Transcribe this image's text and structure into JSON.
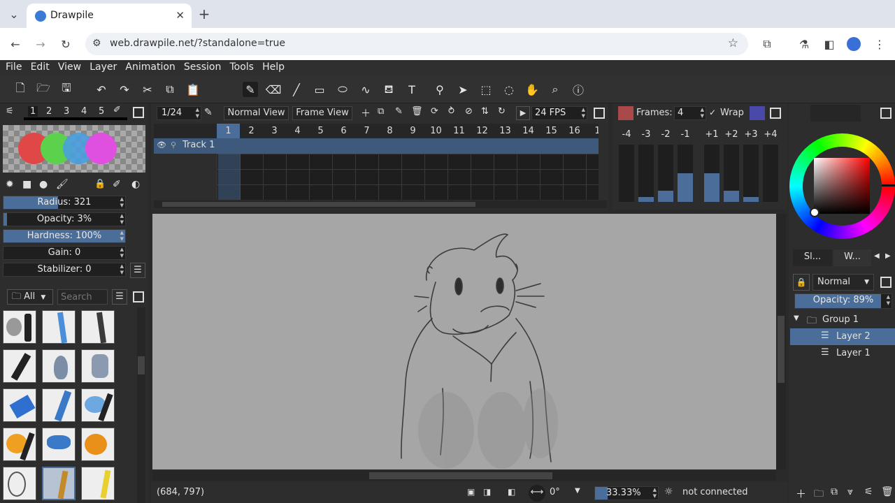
{
  "browser": {
    "tab_title": "Drawpile",
    "url": "web.drawpile.net/?standalone=true"
  },
  "menu": [
    "File",
    "Edit",
    "View",
    "Layer",
    "Animation",
    "Session",
    "Tools",
    "Help"
  ],
  "brush_slots": [
    "1",
    "2",
    "3",
    "4",
    "5"
  ],
  "brush_settings": {
    "radius": "Radius: 321",
    "opacity": "Opacity: 3%",
    "hardness": "Hardness: 100%",
    "gain": "Gain: 0",
    "stabilizer": "Stabilizer: 0",
    "radius_fill": 0.45,
    "opacity_fill": 0.03,
    "hardness_fill": 1.0,
    "gain_fill": 0.0
  },
  "brush_browser": {
    "filter": "All",
    "search_placeholder": "Search"
  },
  "timeline": {
    "frame": "1/24",
    "normal_view": "Normal View",
    "frame_view": "Frame View",
    "fps": "24 FPS",
    "frames": [
      "1",
      "2",
      "3",
      "4",
      "5",
      "6",
      "7",
      "8",
      "9",
      "10",
      "11",
      "12",
      "13",
      "14",
      "15",
      "16",
      "1"
    ],
    "track": "Track 1"
  },
  "onion": {
    "frames_label": "Frames:",
    "frames_value": "4",
    "wrap": "Wrap",
    "labels": [
      "-4",
      "-3",
      "-2",
      "-1",
      "+1",
      "+2",
      "+3",
      "+4"
    ],
    "levels": [
      0.0,
      0.08,
      0.2,
      0.5,
      0.5,
      0.2,
      0.08,
      0.0
    ]
  },
  "status": {
    "coords": "(684, 797)",
    "rotation": "0°",
    "zoom": "33.33%",
    "connection": "not connected"
  },
  "layers": {
    "tab1": "Sl...",
    "tab2": "W...",
    "blend": "Normal",
    "opacity": "Opacity: 89%",
    "opacity_fill": 0.89,
    "items": [
      "Group 1",
      "Layer 2",
      "Layer 1"
    ]
  },
  "colors": {
    "fg": "#000000",
    "bg": "#ffffff",
    "accent": "#4a6e99"
  }
}
